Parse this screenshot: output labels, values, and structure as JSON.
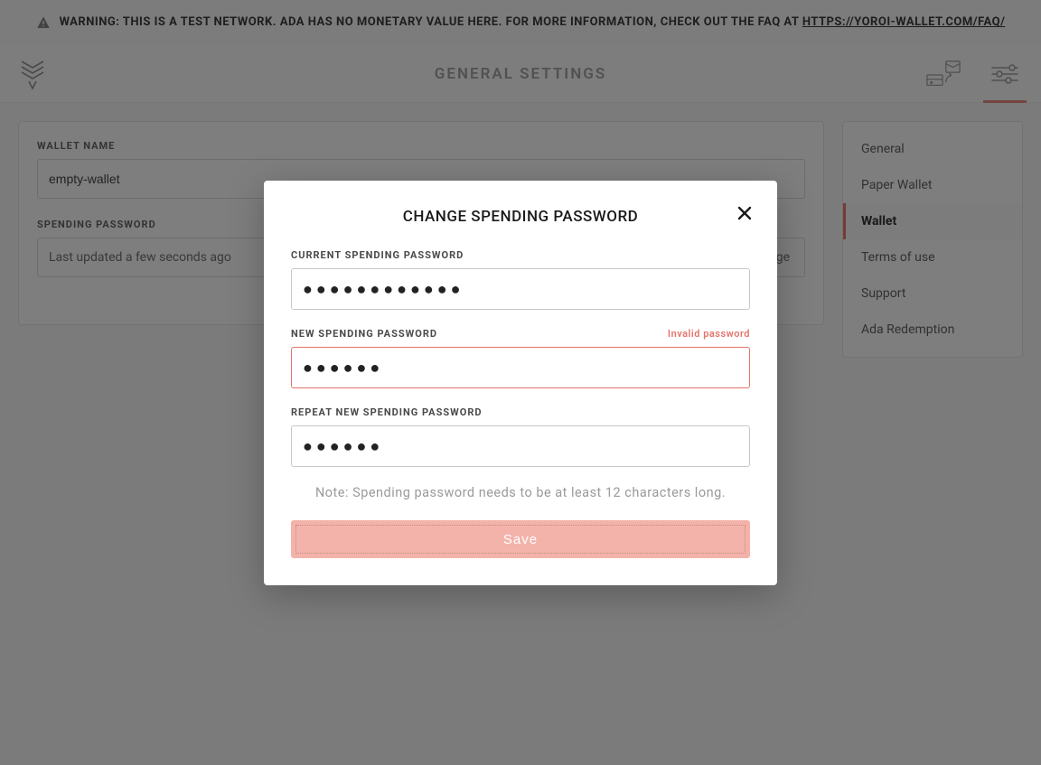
{
  "warning": {
    "text_prefix": "WARNING: THIS IS A TEST NETWORK. ADA HAS NO MONETARY VALUE HERE. FOR MORE INFORMATION, CHECK OUT THE FAQ AT ",
    "link_text": "HTTPS://YOROI-WALLET.COM/FAQ/"
  },
  "header": {
    "title": "GENERAL SETTINGS"
  },
  "settings": {
    "wallet_name_label": "WALLET NAME",
    "wallet_name_value": "empty-wallet",
    "spending_password_label": "SPENDING PASSWORD",
    "spending_password_status": "Last updated a few seconds ago",
    "change_label": "change"
  },
  "sidebar": {
    "items": [
      {
        "label": "General"
      },
      {
        "label": "Paper Wallet"
      },
      {
        "label": "Wallet"
      },
      {
        "label": "Terms of use"
      },
      {
        "label": "Support"
      },
      {
        "label": "Ada Redemption"
      }
    ],
    "active_index": 2
  },
  "modal": {
    "title": "CHANGE SPENDING PASSWORD",
    "current_label": "CURRENT SPENDING PASSWORD",
    "current_value": "●●●●●●●●●●●●",
    "new_label": "NEW SPENDING PASSWORD",
    "new_value": "●●●●●●",
    "new_error": "Invalid password",
    "repeat_label": "REPEAT NEW SPENDING PASSWORD",
    "repeat_value": "●●●●●●",
    "note": "Note: Spending password needs to be at least 12 characters long.",
    "save_label": "Save"
  },
  "colors": {
    "accent": "#ea6a5a",
    "error": "#e4736a"
  }
}
